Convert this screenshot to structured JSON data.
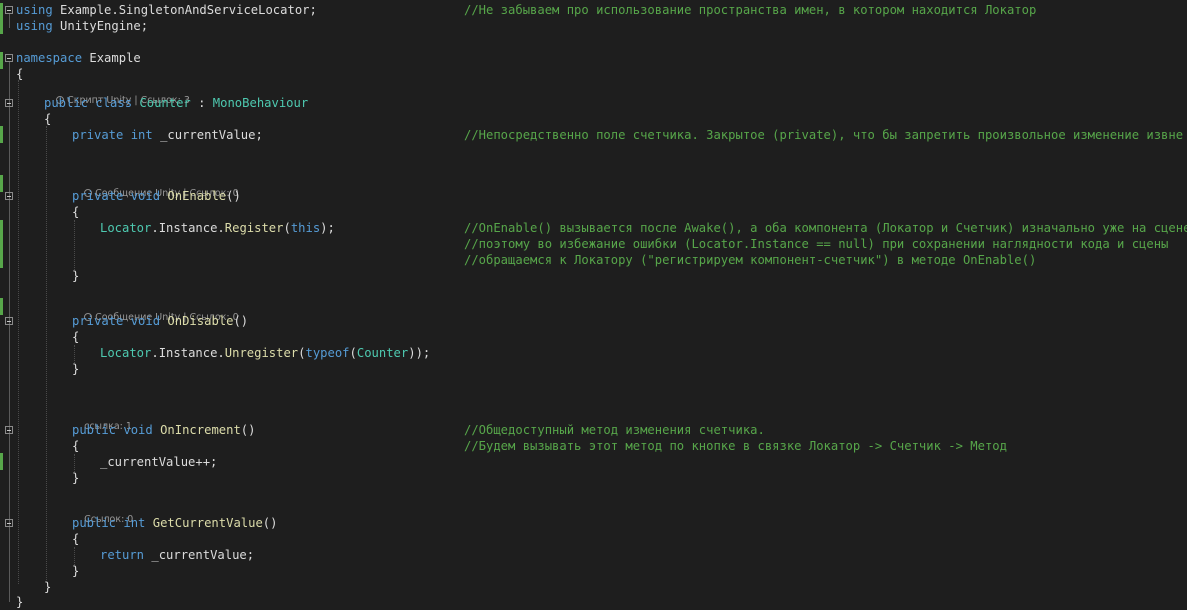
{
  "editor": {
    "lines": [
      {
        "id": "using1",
        "tokens": [
          {
            "k": "kw",
            "t": "using"
          },
          {
            "k": "pl",
            "t": " Example.SingletonAndServiceLocator;"
          }
        ]
      },
      {
        "id": "using1-comment",
        "tokens": [
          {
            "k": "cm",
            "t": "//Не забываем про использование пространства имен, в котором находится Локатор"
          }
        ]
      },
      {
        "id": "using2",
        "tokens": [
          {
            "k": "kw",
            "t": "using"
          },
          {
            "k": "pl",
            "t": " UnityEngine;"
          }
        ]
      },
      {
        "id": "ns",
        "tokens": [
          {
            "k": "kw",
            "t": "namespace"
          },
          {
            "k": "pl",
            "t": " Example"
          }
        ]
      },
      {
        "id": "ns-open",
        "tokens": [
          {
            "k": "pl",
            "t": "{"
          }
        ]
      },
      {
        "id": "class-decl",
        "tokens": [
          {
            "k": "kw",
            "t": "public"
          },
          {
            "k": "pl",
            "t": " "
          },
          {
            "k": "kw",
            "t": "class"
          },
          {
            "k": "pl",
            "t": " "
          },
          {
            "k": "ty",
            "t": "Counter"
          },
          {
            "k": "pl",
            "t": " : "
          },
          {
            "k": "ty",
            "t": "MonoBehaviour"
          }
        ]
      },
      {
        "id": "class-open",
        "tokens": [
          {
            "k": "pl",
            "t": "{"
          }
        ]
      },
      {
        "id": "field",
        "tokens": [
          {
            "k": "kw",
            "t": "private"
          },
          {
            "k": "pl",
            "t": " "
          },
          {
            "k": "kw",
            "t": "int"
          },
          {
            "k": "pl",
            "t": " _currentValue;"
          }
        ]
      },
      {
        "id": "field-comment",
        "tokens": [
          {
            "k": "cm",
            "t": "//Непосредственно поле счетчика. Закрытое (private), что бы запретить произвольное изменение извне"
          }
        ]
      },
      {
        "id": "onenable-decl",
        "tokens": [
          {
            "k": "kw",
            "t": "private"
          },
          {
            "k": "pl",
            "t": " "
          },
          {
            "k": "kw",
            "t": "void"
          },
          {
            "k": "pl",
            "t": " "
          },
          {
            "k": "md",
            "t": "OnEnable"
          },
          {
            "k": "pl",
            "t": "()"
          }
        ]
      },
      {
        "id": "onenable-open",
        "tokens": [
          {
            "k": "pl",
            "t": "{"
          }
        ]
      },
      {
        "id": "register-call",
        "tokens": [
          {
            "k": "ty",
            "t": "Locator"
          },
          {
            "k": "pl",
            "t": "."
          },
          {
            "k": "pl",
            "t": "Instance"
          },
          {
            "k": "pl",
            "t": "."
          },
          {
            "k": "md",
            "t": "Register"
          },
          {
            "k": "pl",
            "t": "("
          },
          {
            "k": "kw",
            "t": "this"
          },
          {
            "k": "pl",
            "t": ");"
          }
        ]
      },
      {
        "id": "register-comment1",
        "tokens": [
          {
            "k": "cm",
            "t": "//OnEnable() вызывается после Awake(), а оба компонента (Локатор и Счетчик) изначально уже на сцене"
          }
        ]
      },
      {
        "id": "register-comment2",
        "tokens": [
          {
            "k": "cm",
            "t": "//поэтому во избежание ошибки (Locator.Instance == null) при сохранении наглядности кода и сцены"
          }
        ]
      },
      {
        "id": "register-comment3",
        "tokens": [
          {
            "k": "cm",
            "t": "//обращаемся к Локатору (\"регистрируем компонент-счетчик\") в методе OnEnable()"
          }
        ]
      },
      {
        "id": "onenable-close",
        "tokens": [
          {
            "k": "pl",
            "t": "}"
          }
        ]
      },
      {
        "id": "ondisable-decl",
        "tokens": [
          {
            "k": "kw",
            "t": "private"
          },
          {
            "k": "pl",
            "t": " "
          },
          {
            "k": "kw",
            "t": "void"
          },
          {
            "k": "pl",
            "t": " "
          },
          {
            "k": "md",
            "t": "OnDisable"
          },
          {
            "k": "pl",
            "t": "()"
          }
        ]
      },
      {
        "id": "ondisable-open",
        "tokens": [
          {
            "k": "pl",
            "t": "{"
          }
        ]
      },
      {
        "id": "unregister-call",
        "tokens": [
          {
            "k": "ty",
            "t": "Locator"
          },
          {
            "k": "pl",
            "t": "."
          },
          {
            "k": "pl",
            "t": "Instance"
          },
          {
            "k": "pl",
            "t": "."
          },
          {
            "k": "md",
            "t": "Unregister"
          },
          {
            "k": "pl",
            "t": "("
          },
          {
            "k": "kw",
            "t": "typeof"
          },
          {
            "k": "pl",
            "t": "("
          },
          {
            "k": "ty",
            "t": "Counter"
          },
          {
            "k": "pl",
            "t": "));"
          }
        ]
      },
      {
        "id": "ondisable-close",
        "tokens": [
          {
            "k": "pl",
            "t": "}"
          }
        ]
      },
      {
        "id": "onincrement-decl",
        "tokens": [
          {
            "k": "kw",
            "t": "public"
          },
          {
            "k": "pl",
            "t": " "
          },
          {
            "k": "kw",
            "t": "void"
          },
          {
            "k": "pl",
            "t": " "
          },
          {
            "k": "md",
            "t": "OnIncrement"
          },
          {
            "k": "pl",
            "t": "()"
          }
        ]
      },
      {
        "id": "onincrement-comment1",
        "tokens": [
          {
            "k": "cm",
            "t": "//Общедоступный метод изменения счетчика."
          }
        ]
      },
      {
        "id": "onincrement-open",
        "tokens": [
          {
            "k": "pl",
            "t": "{"
          }
        ]
      },
      {
        "id": "onincrement-comment2",
        "tokens": [
          {
            "k": "cm",
            "t": "//Будем вызывать этот метод по кнопке в связке Локатор -> Счетчик -> Метод"
          }
        ]
      },
      {
        "id": "increment-stmt",
        "tokens": [
          {
            "k": "pl",
            "t": "_currentValue++;"
          }
        ]
      },
      {
        "id": "onincrement-close",
        "tokens": [
          {
            "k": "pl",
            "t": "}"
          }
        ]
      },
      {
        "id": "getvalue-decl",
        "tokens": [
          {
            "k": "kw",
            "t": "public"
          },
          {
            "k": "pl",
            "t": " "
          },
          {
            "k": "kw",
            "t": "int"
          },
          {
            "k": "pl",
            "t": " "
          },
          {
            "k": "md",
            "t": "GetCurrentValue"
          },
          {
            "k": "pl",
            "t": "()"
          }
        ]
      },
      {
        "id": "getvalue-open",
        "tokens": [
          {
            "k": "pl",
            "t": "{"
          }
        ]
      },
      {
        "id": "return-stmt",
        "tokens": [
          {
            "k": "kw",
            "t": "return"
          },
          {
            "k": "pl",
            "t": " _currentValue;"
          }
        ]
      },
      {
        "id": "getvalue-close",
        "tokens": [
          {
            "k": "pl",
            "t": "}"
          }
        ]
      },
      {
        "id": "class-close",
        "tokens": [
          {
            "k": "pl",
            "t": "}"
          }
        ]
      },
      {
        "id": "ns-close",
        "tokens": [
          {
            "k": "pl",
            "t": "}"
          }
        ]
      }
    ],
    "codelens": [
      {
        "id": "class-lens",
        "icon": "unity-icon",
        "text": "Скрипт Unity | Ссылок: 3"
      },
      {
        "id": "onenable-lens",
        "icon": "unity-icon",
        "text": "Сообщение Unity | Ссылок: 0"
      },
      {
        "id": "ondisable-lens",
        "icon": "unity-icon",
        "text": "Сообщение Unity | Ссылок: 0"
      },
      {
        "id": "onincrement-lens",
        "icon": "",
        "text": "ссылка: 1"
      },
      {
        "id": "getvalue-lens",
        "icon": "",
        "text": "Ссылок: 0"
      }
    ],
    "colors": {
      "background": "#1e1e1e",
      "keyword": "#569cd6",
      "type": "#4ec9b0",
      "method": "#dcdcaa",
      "plain": "#dcdcdc",
      "comment": "#57a64a",
      "changed_margin": "#57a64a"
    }
  }
}
